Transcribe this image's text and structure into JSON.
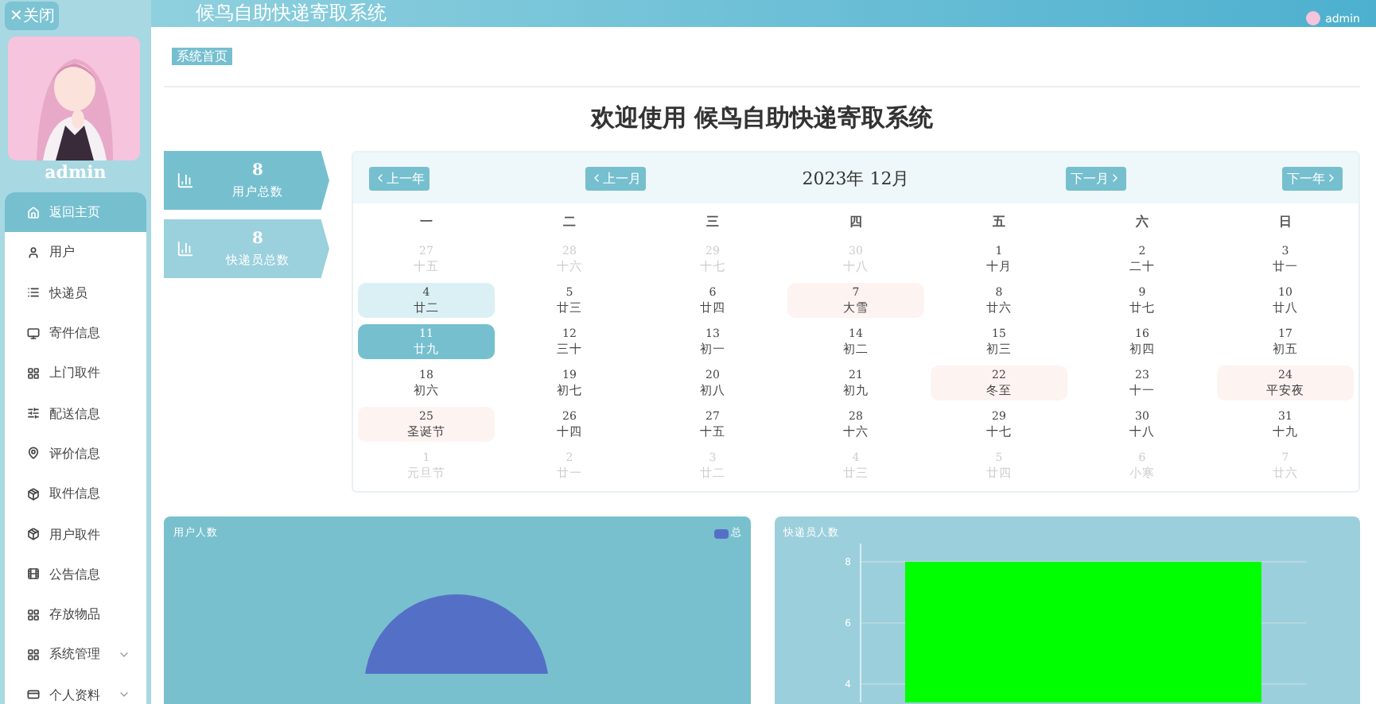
{
  "close_button": "✕关闭",
  "sidebar": {
    "user": "admin",
    "items": [
      {
        "label": "返回主页",
        "selected": true,
        "expandable": false
      },
      {
        "label": "用户",
        "selected": false,
        "expandable": false
      },
      {
        "label": "快递员",
        "selected": false,
        "expandable": false
      },
      {
        "label": "寄件信息",
        "selected": false,
        "expandable": false
      },
      {
        "label": "上门取件",
        "selected": false,
        "expandable": false
      },
      {
        "label": "配送信息",
        "selected": false,
        "expandable": false
      },
      {
        "label": "评价信息",
        "selected": false,
        "expandable": false
      },
      {
        "label": "取件信息",
        "selected": false,
        "expandable": false
      },
      {
        "label": "用户取件",
        "selected": false,
        "expandable": false
      },
      {
        "label": "公告信息",
        "selected": false,
        "expandable": false
      },
      {
        "label": "存放物品",
        "selected": false,
        "expandable": false
      },
      {
        "label": "系统管理",
        "selected": false,
        "expandable": true
      },
      {
        "label": "个人资料",
        "selected": false,
        "expandable": true
      }
    ]
  },
  "header": {
    "title": "候鸟自助快递寄取系统",
    "user": "admin"
  },
  "breadcrumb": "系统首页",
  "welcome": "欢迎使用 候鸟自助快递寄取系统",
  "stats": [
    {
      "value": "8",
      "label": "用户总数"
    },
    {
      "value": "8",
      "label": "快递员总数"
    }
  ],
  "calendar": {
    "prev_year": "上一年",
    "prev_month": "上一月",
    "title": "2023年 12月",
    "next_month": "下一月",
    "next_year": "下一年",
    "weekdays": [
      "一",
      "二",
      "三",
      "四",
      "五",
      "六",
      "日"
    ],
    "weeks": [
      [
        {
          "day": "27",
          "lunar": "十五",
          "muted": true,
          "selected": false,
          "hovered": false,
          "holiday": false
        },
        {
          "day": "28",
          "lunar": "十六",
          "muted": true,
          "selected": false,
          "hovered": false,
          "holiday": false
        },
        {
          "day": "29",
          "lunar": "十七",
          "muted": true,
          "selected": false,
          "hovered": false,
          "holiday": false
        },
        {
          "day": "30",
          "lunar": "十八",
          "muted": true,
          "selected": false,
          "hovered": false,
          "holiday": false
        },
        {
          "day": "1",
          "lunar": "十月",
          "muted": false,
          "selected": false,
          "hovered": false,
          "holiday": false
        },
        {
          "day": "2",
          "lunar": "二十",
          "muted": false,
          "selected": false,
          "hovered": false,
          "holiday": false
        },
        {
          "day": "3",
          "lunar": "廿一",
          "muted": false,
          "selected": false,
          "hovered": false,
          "holiday": false
        }
      ],
      [
        {
          "day": "4",
          "lunar": "廿二",
          "muted": false,
          "selected": false,
          "hovered": true,
          "holiday": false
        },
        {
          "day": "5",
          "lunar": "廿三",
          "muted": false,
          "selected": false,
          "hovered": false,
          "holiday": false
        },
        {
          "day": "6",
          "lunar": "廿四",
          "muted": false,
          "selected": false,
          "hovered": false,
          "holiday": false
        },
        {
          "day": "7",
          "lunar": "大雪",
          "muted": false,
          "selected": false,
          "hovered": false,
          "holiday": true
        },
        {
          "day": "8",
          "lunar": "廿六",
          "muted": false,
          "selected": false,
          "hovered": false,
          "holiday": false
        },
        {
          "day": "9",
          "lunar": "廿七",
          "muted": false,
          "selected": false,
          "hovered": false,
          "holiday": false
        },
        {
          "day": "10",
          "lunar": "廿八",
          "muted": false,
          "selected": false,
          "hovered": false,
          "holiday": false
        }
      ],
      [
        {
          "day": "11",
          "lunar": "廿九",
          "muted": false,
          "selected": true,
          "hovered": false,
          "holiday": false
        },
        {
          "day": "12",
          "lunar": "三十",
          "muted": false,
          "selected": false,
          "hovered": false,
          "holiday": false
        },
        {
          "day": "13",
          "lunar": "初一",
          "muted": false,
          "selected": false,
          "hovered": false,
          "holiday": false
        },
        {
          "day": "14",
          "lunar": "初二",
          "muted": false,
          "selected": false,
          "hovered": false,
          "holiday": false
        },
        {
          "day": "15",
          "lunar": "初三",
          "muted": false,
          "selected": false,
          "hovered": false,
          "holiday": false
        },
        {
          "day": "16",
          "lunar": "初四",
          "muted": false,
          "selected": false,
          "hovered": false,
          "holiday": false
        },
        {
          "day": "17",
          "lunar": "初五",
          "muted": false,
          "selected": false,
          "hovered": false,
          "holiday": false
        }
      ],
      [
        {
          "day": "18",
          "lunar": "初六",
          "muted": false,
          "selected": false,
          "hovered": false,
          "holiday": false
        },
        {
          "day": "19",
          "lunar": "初七",
          "muted": false,
          "selected": false,
          "hovered": false,
          "holiday": false
        },
        {
          "day": "20",
          "lunar": "初八",
          "muted": false,
          "selected": false,
          "hovered": false,
          "holiday": false
        },
        {
          "day": "21",
          "lunar": "初九",
          "muted": false,
          "selected": false,
          "hovered": false,
          "holiday": false
        },
        {
          "day": "22",
          "lunar": "冬至",
          "muted": false,
          "selected": false,
          "hovered": false,
          "holiday": true
        },
        {
          "day": "23",
          "lunar": "十一",
          "muted": false,
          "selected": false,
          "hovered": false,
          "holiday": false
        },
        {
          "day": "24",
          "lunar": "平安夜",
          "muted": false,
          "selected": false,
          "hovered": false,
          "holiday": true
        }
      ],
      [
        {
          "day": "25",
          "lunar": "圣诞节",
          "muted": false,
          "selected": false,
          "hovered": false,
          "holiday": true
        },
        {
          "day": "26",
          "lunar": "十四",
          "muted": false,
          "selected": false,
          "hovered": false,
          "holiday": false
        },
        {
          "day": "27",
          "lunar": "十五",
          "muted": false,
          "selected": false,
          "hovered": false,
          "holiday": false
        },
        {
          "day": "28",
          "lunar": "十六",
          "muted": false,
          "selected": false,
          "hovered": false,
          "holiday": false
        },
        {
          "day": "29",
          "lunar": "十七",
          "muted": false,
          "selected": false,
          "hovered": false,
          "holiday": false
        },
        {
          "day": "30",
          "lunar": "十八",
          "muted": false,
          "selected": false,
          "hovered": false,
          "holiday": false
        },
        {
          "day": "31",
          "lunar": "十九",
          "muted": false,
          "selected": false,
          "hovered": false,
          "holiday": false
        }
      ],
      [
        {
          "day": "1",
          "lunar": "元旦节",
          "muted": true,
          "selected": false,
          "hovered": false,
          "holiday": false
        },
        {
          "day": "2",
          "lunar": "廿一",
          "muted": true,
          "selected": false,
          "hovered": false,
          "holiday": false
        },
        {
          "day": "3",
          "lunar": "廿二",
          "muted": true,
          "selected": false,
          "hovered": false,
          "holiday": false
        },
        {
          "day": "4",
          "lunar": "廿三",
          "muted": true,
          "selected": false,
          "hovered": false,
          "holiday": false
        },
        {
          "day": "5",
          "lunar": "廿四",
          "muted": true,
          "selected": false,
          "hovered": false,
          "holiday": false
        },
        {
          "day": "6",
          "lunar": "小寒",
          "muted": true,
          "selected": false,
          "hovered": false,
          "holiday": false
        },
        {
          "day": "7",
          "lunar": "廿六",
          "muted": true,
          "selected": false,
          "hovered": false,
          "holiday": false
        }
      ]
    ]
  },
  "user_chart": {
    "title": "用户人数",
    "legend": "总"
  },
  "courier_chart": {
    "title": "快递员人数",
    "chart_data": {
      "type": "bar",
      "ylim": [
        3.4,
        8.6
      ],
      "yticks": [
        4,
        6,
        8
      ],
      "grid": true,
      "series": [
        {
          "color": "#00ff00",
          "values": [
            8
          ]
        }
      ]
    }
  }
}
